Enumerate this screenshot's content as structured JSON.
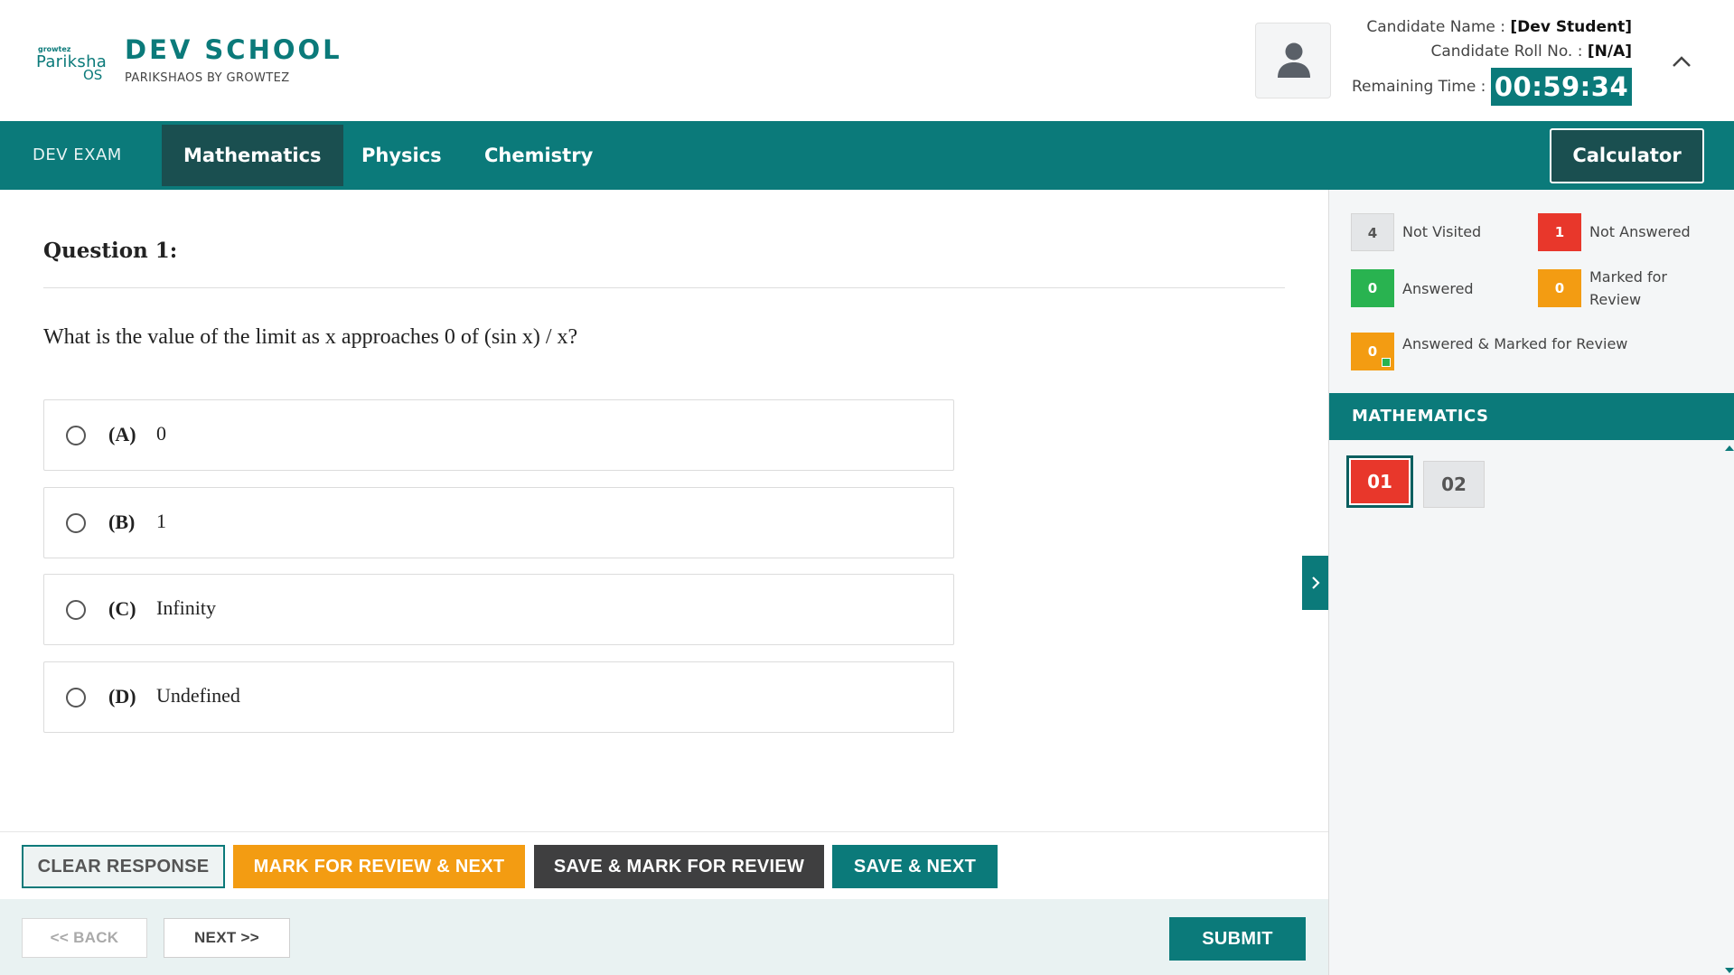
{
  "header": {
    "logo": {
      "small": "growtez",
      "main": "Pariksha",
      "os": "OS"
    },
    "school_name": "DEV SCHOOL",
    "school_sub": "PARIKSHAOS BY GROWTEZ",
    "avatar_icon": "user-icon",
    "candidate_name_label": "Candidate Name : ",
    "candidate_name_value": "[Dev Student]",
    "roll_label": "Candidate Roll No. : ",
    "roll_value": "[N/A]",
    "remaining_time_label": "Remaining Time :",
    "timer": "00:59:34",
    "collapse_icon": "chevron-up-icon"
  },
  "nav": {
    "exam_name": "DEV EXAM",
    "tabs": [
      {
        "label": "Mathematics",
        "active": true
      },
      {
        "label": "Physics",
        "active": false
      },
      {
        "label": "Chemistry",
        "active": false
      }
    ],
    "calculator_label": "Calculator"
  },
  "question": {
    "title": "Question 1:",
    "text": "What is the value of the limit as x approaches 0 of (sin x) / x?",
    "options": [
      {
        "letter": "(A)",
        "text": "0"
      },
      {
        "letter": "(B)",
        "text": "1"
      },
      {
        "letter": "(C)",
        "text": "Infinity"
      },
      {
        "letter": "(D)",
        "text": "Undefined"
      }
    ]
  },
  "actions": {
    "clear": "CLEAR RESPONSE",
    "mark_review_next": "MARK FOR REVIEW & NEXT",
    "save_mark_review": "SAVE & MARK FOR REVIEW",
    "save_next": "SAVE & NEXT",
    "back": "<< BACK",
    "next": "NEXT >>",
    "submit": "SUBMIT"
  },
  "legend": {
    "not_visited": {
      "count": "4",
      "label": "Not Visited"
    },
    "not_answered": {
      "count": "1",
      "label": "Not Answered"
    },
    "answered": {
      "count": "0",
      "label": "Answered"
    },
    "marked": {
      "count": "0",
      "label": "Marked for Review"
    },
    "answered_marked": {
      "count": "0",
      "label": "Answered & Marked for Review"
    }
  },
  "palette": {
    "section": "MATHEMATICS",
    "questions": [
      "01",
      "02"
    ]
  },
  "colors": {
    "primary": "#0b7a7a",
    "dark_teal": "#1a4f50",
    "red": "#e8372b",
    "green": "#29b350",
    "orange": "#f39c12",
    "dark_gray": "#3f3f40"
  }
}
